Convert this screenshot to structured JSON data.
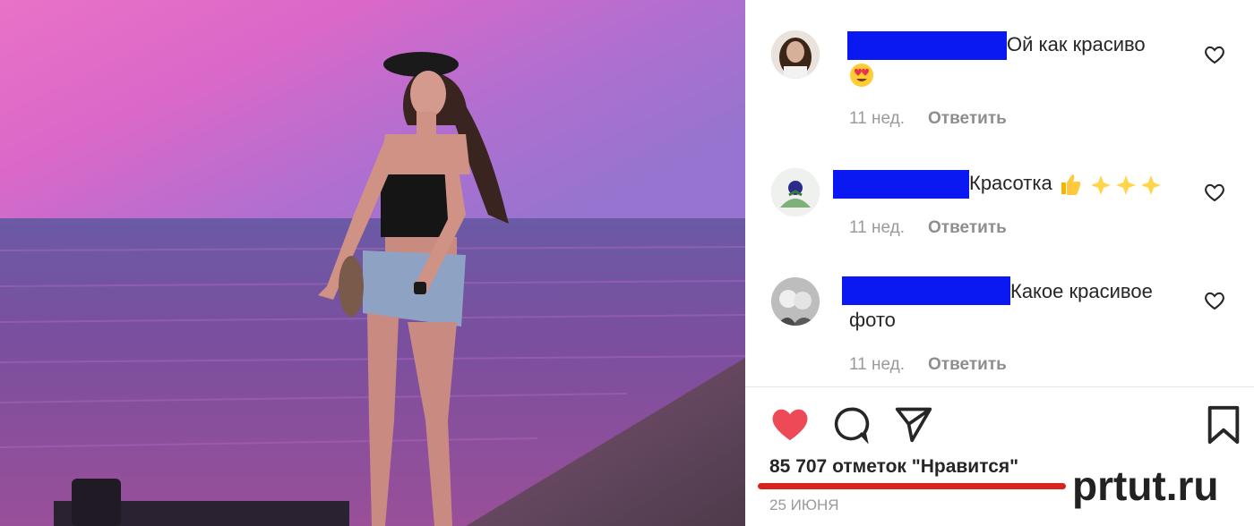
{
  "photo": {
    "description_icon": "photo-image"
  },
  "comments": [
    {
      "text": "Ой как красиво",
      "time": "11 нед.",
      "reply": "Ответить",
      "emoji": "heart-eyes-emoji"
    },
    {
      "text": "Красотка",
      "time": "11 нед.",
      "reply": "Ответить",
      "emoji": "thumbs-up-sparkles-emoji"
    },
    {
      "text": "Какое красивое",
      "text2": "фото",
      "time": "11 нед.",
      "reply": "Ответить"
    }
  ],
  "likes": "85 707 отметок \"Нравится\"",
  "date": "25 ИЮНЯ",
  "watermark": "prtut.ru",
  "colors": {
    "redaction": "#0a18f2",
    "like_red": "#ed4956",
    "underline": "#d9241e"
  }
}
